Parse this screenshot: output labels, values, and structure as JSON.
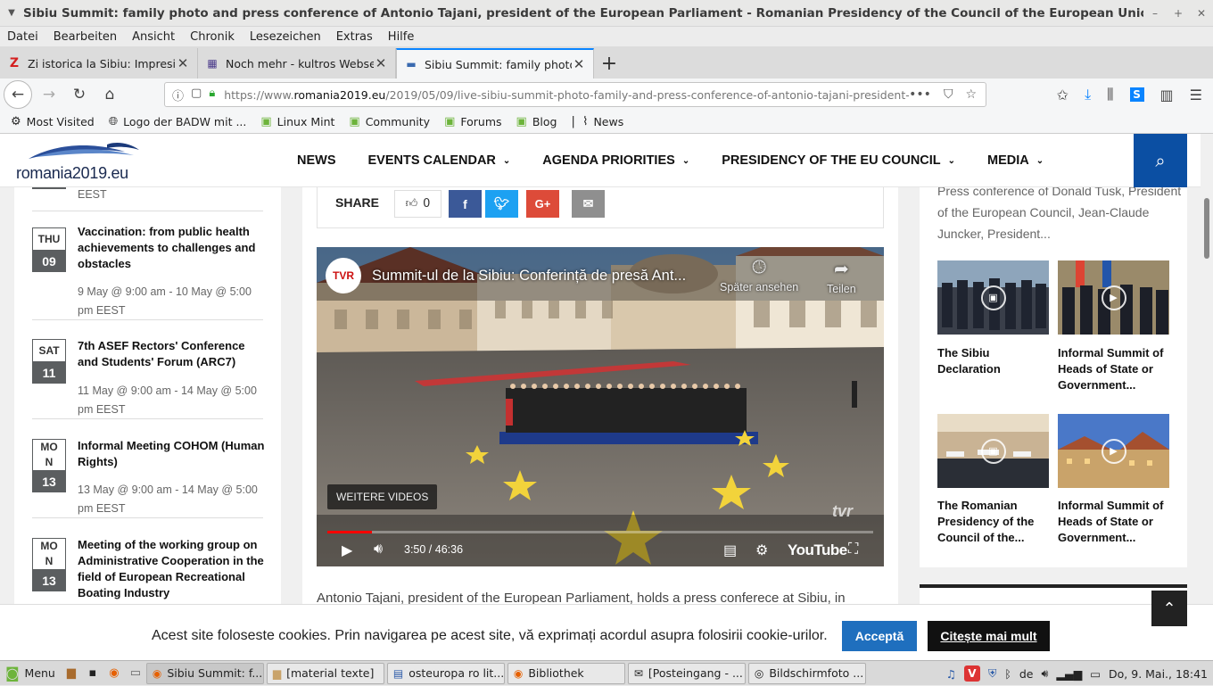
{
  "window": {
    "title": "Sibiu Summit: family photo and press conference of Antonio Tajani, president of the European Parliament - Romanian Presidency of the Council of the European Union - Mozilla Firefox"
  },
  "menubar": [
    "Datei",
    "Bearbeiten",
    "Ansicht",
    "Chronik",
    "Lesezeichen",
    "Extras",
    "Hilfe"
  ],
  "tabs": [
    {
      "label": "Zi istorica la Sibiu: Impresionan",
      "icon": "z-favicon"
    },
    {
      "label": "Noch mehr - kultros Webseite",
      "icon": "kultros-favicon"
    },
    {
      "label": "Sibiu Summit: family photo and",
      "icon": "romania2019-favicon"
    }
  ],
  "urlbar": {
    "prefix": "https://www.",
    "domain": "romania2019.eu",
    "path": "/2019/05/09/live-sibiu-summit-photo-family-and-press-conference-of-antonio-tajani-president-of-the-eu..."
  },
  "bookmarks": [
    "Most Visited",
    "Logo der BADW mit ...",
    "Linux Mint",
    "Community",
    "Forums",
    "Blog",
    "News"
  ],
  "site": {
    "logo_text": "romania2019.eu",
    "nav": [
      "NEWS",
      "EVENTS CALENDAR",
      "AGENDA PRIORITIES",
      "PRESIDENCY OF THE EU COUNCIL",
      "MEDIA"
    ]
  },
  "events": {
    "top_fragment": "EEST",
    "items": [
      {
        "dow": "THU",
        "day": "09",
        "title": "Vaccination: from public health achievements to challenges and obstacles",
        "date1": "9 May @ 9:00 am - 10 May @ 5:00",
        "date2": "pm EEST"
      },
      {
        "dow": "SAT",
        "day": "11",
        "title": "7th ASEF Rectors' Conference and Students' Forum (ARC7)",
        "date1": "11 May @ 9:00 am - 14 May @ 5:00",
        "date2": "pm EEST"
      },
      {
        "dow": "MO N",
        "day": "13",
        "title": "Informal Meeting COHOM (Human Rights)",
        "date1": "13 May @ 9:00 am - 14 May @ 5:00",
        "date2": "pm EEST"
      },
      {
        "dow": "MO N",
        "day": "13",
        "title": "Meeting of the working group on Administrative Cooperation in the field of European Recreational Boating Industry",
        "date1": "",
        "date2": ""
      }
    ]
  },
  "share": {
    "label": "SHARE",
    "likes": "0"
  },
  "video": {
    "channel": "TVR",
    "title": "Summit-ul de la Sibiu: Conferință de presă Ant...",
    "watch_later": "Später ansehen",
    "share": "Teilen",
    "more_videos": "WEITERE VIDEOS",
    "time": "3:50 / 46:36",
    "progress": 0.082,
    "brand": "YouTube",
    "watermark": "tvr"
  },
  "article": {
    "text": "Antonio Tajani, president of the European Parliament, holds a press conferece at Sibiu, in"
  },
  "sidebar": {
    "text": "Press conference of Donald Tusk, President of the European Council, Jean-Claude Juncker, President...",
    "cards": [
      {
        "caption": "The Sibiu Declaration",
        "icon": "gallery-icon"
      },
      {
        "caption": "Informal Summit of Heads of State or Government...",
        "icon": "play-icon"
      },
      {
        "caption": "The Romanian Presidency of the Council of the...",
        "icon": "gallery-icon"
      },
      {
        "caption": "Informal Summit of Heads of State or Government...",
        "icon": "play-icon"
      }
    ]
  },
  "cookie": {
    "text": "Acest site foloseste cookies. Prin navigarea pe acest site, vă exprimați acordul asupra folosirii cookie-urilor.",
    "accept": "Acceptă",
    "more": "Citește mai mult"
  },
  "taskbar": {
    "menu": "Menu",
    "apps": [
      "Sibiu Summit: f...",
      "[material texte]",
      "osteuropa ro lit...",
      "Bibliothek",
      "[Posteingang - ...",
      "Bildschirmfoto ..."
    ],
    "lang": "de",
    "clock": "Do,  9. Mai., 18:41"
  },
  "colors": {
    "accent": "#0b4fa3",
    "facebook": "#3b5998",
    "twitter": "#1da1f2",
    "gplus": "#dd4b39",
    "email": "#8f8f8f",
    "accept": "#1f6fbe"
  }
}
